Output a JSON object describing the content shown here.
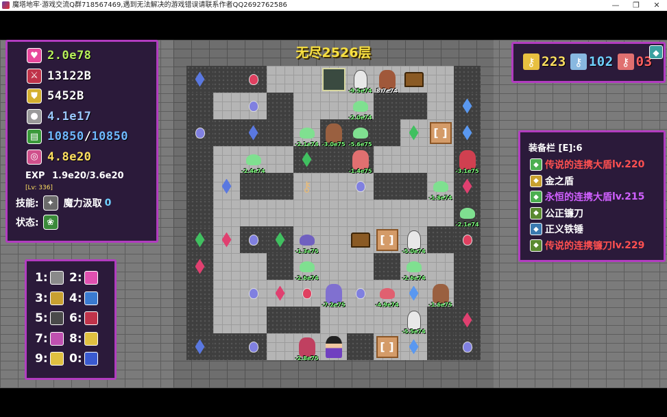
{
  "window": {
    "title": "魔塔地牢·游戏交流Q群718567469,遇到无法解决的游戏错误请联系作者QQ2692762586",
    "minimize": "—",
    "restore": "❐",
    "close": "✕"
  },
  "floor_title": "无尽2526层",
  "stats": [
    {
      "icon": "heart-icon",
      "symbol": "♥",
      "color": "#e8479c",
      "value": "2.0e78",
      "value_color": "#b7f05a"
    },
    {
      "icon": "sword-icon",
      "symbol": "⚔",
      "color": "#c0334a",
      "value": "13122B",
      "value_color": "#ffffff"
    },
    {
      "icon": "shield-icon",
      "symbol": "⛊",
      "color": "#d4b030",
      "value": "5452B",
      "value_color": "#ffffff"
    },
    {
      "icon": "orb-icon",
      "symbol": "●",
      "color": "#9a9a9a",
      "value": "4.1e17",
      "value_color": "#9cc8ff"
    },
    {
      "icon": "book-icon",
      "symbol": "▤",
      "color": "#3a9a3a",
      "value": "10850",
      "value_color": "#6fb8ff",
      "max": "10850"
    },
    {
      "icon": "gem-icon",
      "symbol": "◎",
      "color": "#d0508c",
      "value": "4.8e20",
      "value_color": "#ffe060"
    }
  ],
  "exp": {
    "label": "EXP",
    "value": "1.9e20/3.6e20"
  },
  "level": "[Lv: 336]",
  "skills": {
    "label": "技能:",
    "name": "魔力汲取",
    "count": "0"
  },
  "status": {
    "label": "状态:"
  },
  "keys": [
    {
      "icon": "yellow-key-icon",
      "color": "#e8c040",
      "count": "223",
      "text_color": "#ffe060"
    },
    {
      "icon": "blue-key-icon",
      "color": "#88b8e0",
      "count": "102",
      "text_color": "#6fd0ff"
    },
    {
      "icon": "red-key-icon",
      "color": "#e07070",
      "count": "03",
      "text_color": "#ff6060"
    }
  ],
  "equipment": {
    "header": "装备栏 [E]:6",
    "items": [
      {
        "name": "传说的连携大盾",
        "level": "lv.220",
        "color": "#ff5050",
        "icon": "green-shield-icon",
        "icon_color": "#4caf50"
      },
      {
        "name": "金之盾",
        "level": "",
        "color": "#ffffff",
        "icon": "gold-shield-icon",
        "icon_color": "#c8a030"
      },
      {
        "name": "永恒的连携大盾",
        "level": "lv.215",
        "color": "#d060ff",
        "icon": "green-shield-icon",
        "icon_color": "#4caf50"
      },
      {
        "name": "公正镰刀",
        "level": "",
        "color": "#ffffff",
        "icon": "scythe-icon",
        "icon_color": "#5a8a30"
      },
      {
        "name": "正义铁锤",
        "level": "",
        "color": "#ffffff",
        "icon": "hammer-icon",
        "icon_color": "#3a7ab0"
      },
      {
        "name": "传说的连携镰刀",
        "level": "lv.229",
        "color": "#ff5050",
        "icon": "scythe-icon",
        "icon_color": "#5a8a30"
      }
    ]
  },
  "hotkeys": [
    {
      "key": "1:",
      "icon": "skill-1-icon",
      "color": "#8a8a8a"
    },
    {
      "key": "2:",
      "icon": "skill-2-icon",
      "color": "#e050b0"
    },
    {
      "key": "3:",
      "icon": "skill-3-icon",
      "color": "#c8a030"
    },
    {
      "key": "4:",
      "icon": "skill-4-icon",
      "color": "#3a7ad0"
    },
    {
      "key": "5:",
      "icon": "skill-5-icon",
      "color": "#4a4a4a"
    },
    {
      "key": "6:",
      "icon": "skill-6-icon",
      "color": "#c0334a"
    },
    {
      "key": "7:",
      "icon": "skill-7-icon",
      "color": "#c050b0"
    },
    {
      "key": "8:",
      "icon": "skill-8-icon",
      "color": "#e0c040"
    },
    {
      "key": "9:",
      "icon": "skill-9-icon",
      "color": "#e0c040"
    },
    {
      "key": "0:",
      "icon": "skill-0-icon",
      "color": "#3a5ad0"
    }
  ],
  "map_rows": [
    "WWWFFFFFFFW",
    "WFFWFFFWWFW",
    "WWWWFWWWFFW",
    "WFFFWWWFFFW",
    "WFWWFFFWWFW",
    "WFFFFFFFFFW",
    "WFWWFFFFFWW",
    "WFFWFFFWFFW",
    "WFFFFFFFFFW",
    "WFFWWFFFFWW",
    "WWWFFFWFFWW"
  ],
  "entities": [
    {
      "r": 0,
      "c": 0,
      "type": "gem",
      "color": "#5a78e0"
    },
    {
      "r": 0,
      "c": 2,
      "type": "potion",
      "color": "#e04060"
    },
    {
      "r": 0,
      "c": 5,
      "type": "stairs"
    },
    {
      "r": 0,
      "c": 6,
      "type": "skeleton",
      "dmg": "-9.5e74",
      "dmg_color": "#7dff7d"
    },
    {
      "r": 0,
      "c": 7,
      "type": "monster",
      "color": "#a0583a",
      "dmg": "8.7e74",
      "dmg_color": "#ffffff"
    },
    {
      "r": 0,
      "c": 8,
      "type": "chest"
    },
    {
      "r": 1,
      "c": 2,
      "type": "potion",
      "color": "#8080e0"
    },
    {
      "r": 1,
      "c": 6,
      "type": "slime",
      "color": "#7fe090",
      "dmg": "-2.0e74",
      "dmg_color": "#7dff7d"
    },
    {
      "r": 1,
      "c": 10,
      "type": "gem",
      "color": "#5a98f0"
    },
    {
      "r": 2,
      "c": 0,
      "type": "potion",
      "color": "#8080e0"
    },
    {
      "r": 2,
      "c": 2,
      "type": "gem",
      "color": "#5a78e0"
    },
    {
      "r": 2,
      "c": 4,
      "type": "slime",
      "color": "#7fe090",
      "dmg": "-2.1e74",
      "dmg_color": "#7dff7d"
    },
    {
      "r": 2,
      "c": 5,
      "type": "monster",
      "color": "#9a6040",
      "dmg": "-3.0e75",
      "dmg_color": "#7dff7d"
    },
    {
      "r": 2,
      "c": 6,
      "type": "slime",
      "color": "#7fe090",
      "dmg": "-5.6e75",
      "dmg_color": "#7dff7d"
    },
    {
      "r": 2,
      "c": 8,
      "type": "gem",
      "color": "#40c060"
    },
    {
      "r": 2,
      "c": 9,
      "type": "door",
      "label": "[ ]"
    },
    {
      "r": 2,
      "c": 10,
      "type": "gem",
      "color": "#5a98f0"
    },
    {
      "r": 3,
      "c": 2,
      "type": "slime",
      "color": "#7fe090",
      "dmg": "-2.4e74",
      "dmg_color": "#7dff7d"
    },
    {
      "r": 3,
      "c": 4,
      "type": "gem",
      "color": "#40c060"
    },
    {
      "r": 3,
      "c": 6,
      "type": "monster",
      "color": "#e07070",
      "dmg": "-1.4e75",
      "dmg_color": "#7dff7d"
    },
    {
      "r": 3,
      "c": 10,
      "type": "monster",
      "color": "#d04050",
      "dmg": "-3.1e75",
      "dmg_color": "#7dff7d"
    },
    {
      "r": 4,
      "c": 1,
      "type": "gem",
      "color": "#5a78e0"
    },
    {
      "r": 4,
      "c": 4,
      "type": "key"
    },
    {
      "r": 4,
      "c": 6,
      "type": "potion",
      "color": "#8080e0"
    },
    {
      "r": 4,
      "c": 9,
      "type": "slime",
      "color": "#7fe090",
      "dmg": "-1.8e74",
      "dmg_color": "#7dff7d"
    },
    {
      "r": 4,
      "c": 10,
      "type": "gem",
      "color": "#e04070"
    },
    {
      "r": 5,
      "c": 10,
      "type": "slime",
      "color": "#7fe090",
      "dmg": "-2.1e74",
      "dmg_color": "#7dff7d"
    },
    {
      "r": 6,
      "c": 0,
      "type": "gem",
      "color": "#40c060"
    },
    {
      "r": 6,
      "c": 1,
      "type": "gem",
      "color": "#e04070"
    },
    {
      "r": 6,
      "c": 2,
      "type": "potion",
      "color": "#8080e0"
    },
    {
      "r": 6,
      "c": 3,
      "type": "gem",
      "color": "#40c060"
    },
    {
      "r": 6,
      "c": 4,
      "type": "slime",
      "color": "#7060c0",
      "dmg": "-1.3e75",
      "dmg_color": "#7dff7d"
    },
    {
      "r": 6,
      "c": 6,
      "type": "chest"
    },
    {
      "r": 6,
      "c": 7,
      "type": "door",
      "label": "[ ]"
    },
    {
      "r": 6,
      "c": 8,
      "type": "skeleton",
      "dmg": "-5.0e74",
      "dmg_color": "#7dff7d"
    },
    {
      "r": 6,
      "c": 10,
      "type": "potion",
      "color": "#e04060"
    },
    {
      "r": 7,
      "c": 0,
      "type": "gem",
      "color": "#e04070"
    },
    {
      "r": 7,
      "c": 4,
      "type": "slime",
      "color": "#7fe090",
      "dmg": "-2.6e74",
      "dmg_color": "#7dff7d"
    },
    {
      "r": 7,
      "c": 8,
      "type": "slime",
      "color": "#7fe090",
      "dmg": "-2.6e74",
      "dmg_color": "#7dff7d"
    },
    {
      "r": 8,
      "c": 2,
      "type": "potion",
      "color": "#8080e0"
    },
    {
      "r": 8,
      "c": 3,
      "type": "gem",
      "color": "#e04070"
    },
    {
      "r": 8,
      "c": 4,
      "type": "potion",
      "color": "#e04060"
    },
    {
      "r": 8,
      "c": 5,
      "type": "monster",
      "color": "#8070d0",
      "dmg": "-7.2e75",
      "dmg_color": "#7dff7d"
    },
    {
      "r": 8,
      "c": 6,
      "type": "potion",
      "color": "#8080e0"
    },
    {
      "r": 8,
      "c": 7,
      "type": "slime",
      "color": "#e06070",
      "dmg": "-4.9e74",
      "dmg_color": "#7dff7d"
    },
    {
      "r": 8,
      "c": 8,
      "type": "gem",
      "color": "#5a98f0"
    },
    {
      "r": 8,
      "c": 9,
      "type": "monster",
      "color": "#9a6040",
      "dmg": "-1.6e75",
      "dmg_color": "#7dff7d"
    },
    {
      "r": 9,
      "c": 8,
      "type": "skeleton",
      "dmg": "-5.5e74",
      "dmg_color": "#7dff7d"
    },
    {
      "r": 9,
      "c": 10,
      "type": "gem",
      "color": "#e04070"
    },
    {
      "r": 10,
      "c": 0,
      "type": "gem",
      "color": "#5a78e0"
    },
    {
      "r": 10,
      "c": 2,
      "type": "potion",
      "color": "#8080e0"
    },
    {
      "r": 10,
      "c": 4,
      "type": "monster",
      "color": "#c04060",
      "dmg": "-2.8e75",
      "dmg_color": "#7dff7d"
    },
    {
      "r": 10,
      "c": 5,
      "type": "hero"
    },
    {
      "r": 10,
      "c": 7,
      "type": "door",
      "label": "[ ]"
    },
    {
      "r": 10,
      "c": 8,
      "type": "gem",
      "color": "#5a98f0"
    },
    {
      "r": 10,
      "c": 10,
      "type": "potion",
      "color": "#8080e0"
    }
  ]
}
